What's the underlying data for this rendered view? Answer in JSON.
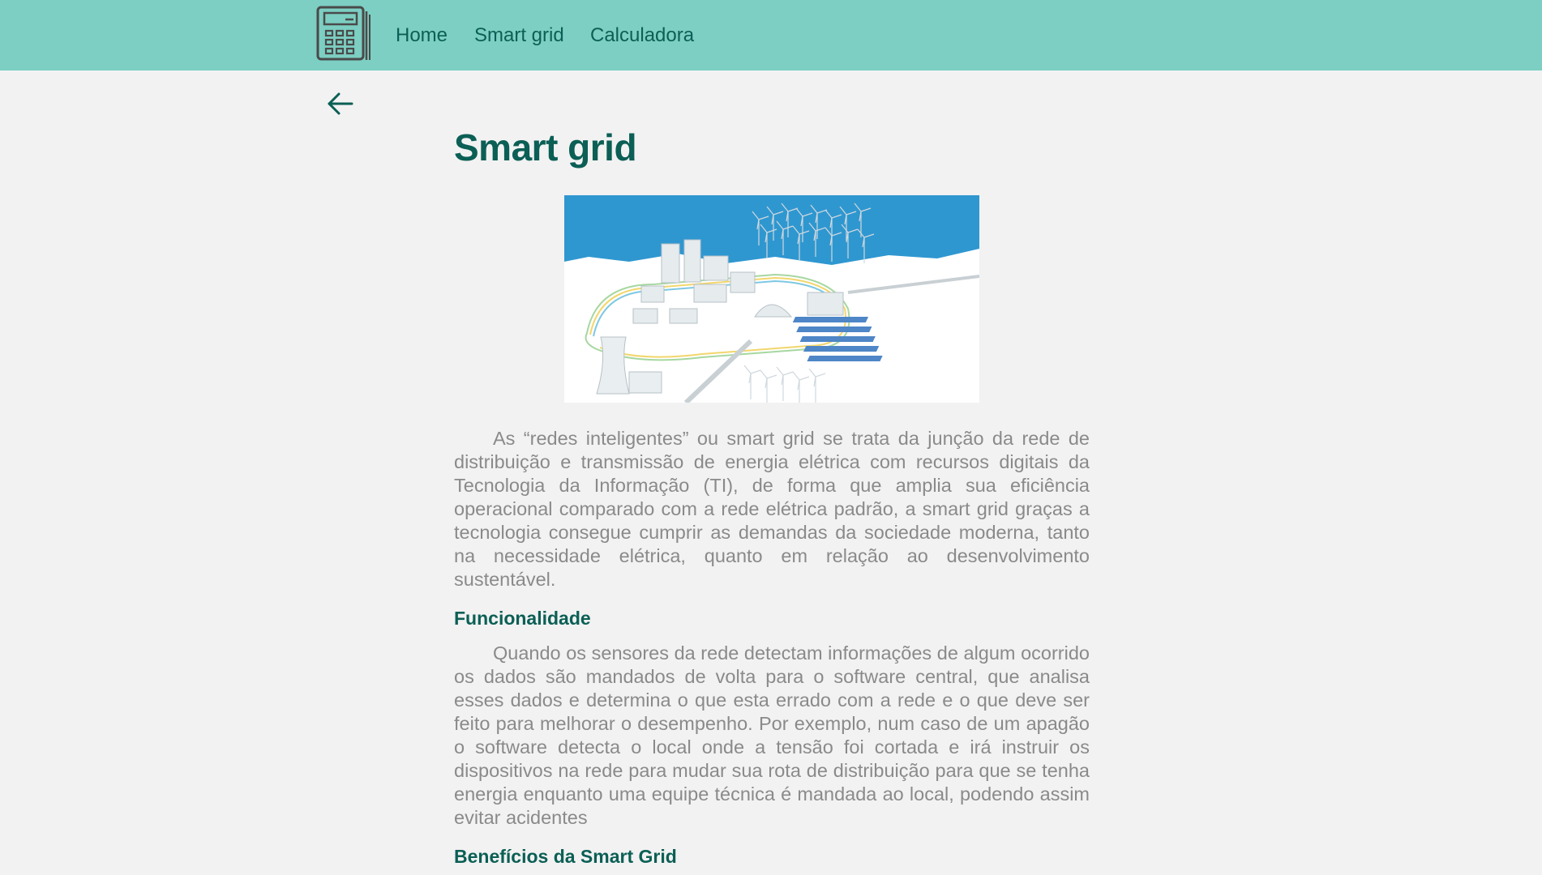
{
  "nav": {
    "logo_icon": "calculator-icon",
    "links": [
      "Home",
      "Smart grid",
      "Calculadora"
    ]
  },
  "back_icon": "arrow-left-icon",
  "article": {
    "title": "Smart grid",
    "image_icon": "smart-grid-illustration",
    "intro": "As “redes inteligentes” ou smart grid se trata da junção da rede de distribuição e transmissão de energia elétrica com recursos digitais da Tecnologia da Informação (TI), de forma que amplia sua eficiência operacional comparado com a rede elétrica padrão, a smart grid graças a tecnologia consegue cumprir as demandas da sociedade moderna, tanto na necessidade elétrica, quanto em relação ao desenvolvimento sustentável.",
    "sections": [
      {
        "heading": "Funcionalidade",
        "text": "Quando os sensores da rede detectam informações de algum ocorrido os dados são mandados de volta para o software central, que analisa esses dados e determina o que esta errado com a rede e o que deve ser feito para melhorar o desempenho. Por exemplo, num caso de um apagão o software detecta o local onde a tensão foi cortada e irá instruir os dispositivos na rede para mudar sua rota de distribuição para que se tenha energia enquanto uma equipe técnica é mandada ao local, podendo assim evitar acidentes"
      },
      {
        "heading": "Benefícios da Smart Grid"
      }
    ]
  },
  "colors": {
    "navbar": "#7ccfc2",
    "accent": "#0b5f55",
    "body_text": "#8a8a8a",
    "background": "#f2f2f2"
  }
}
